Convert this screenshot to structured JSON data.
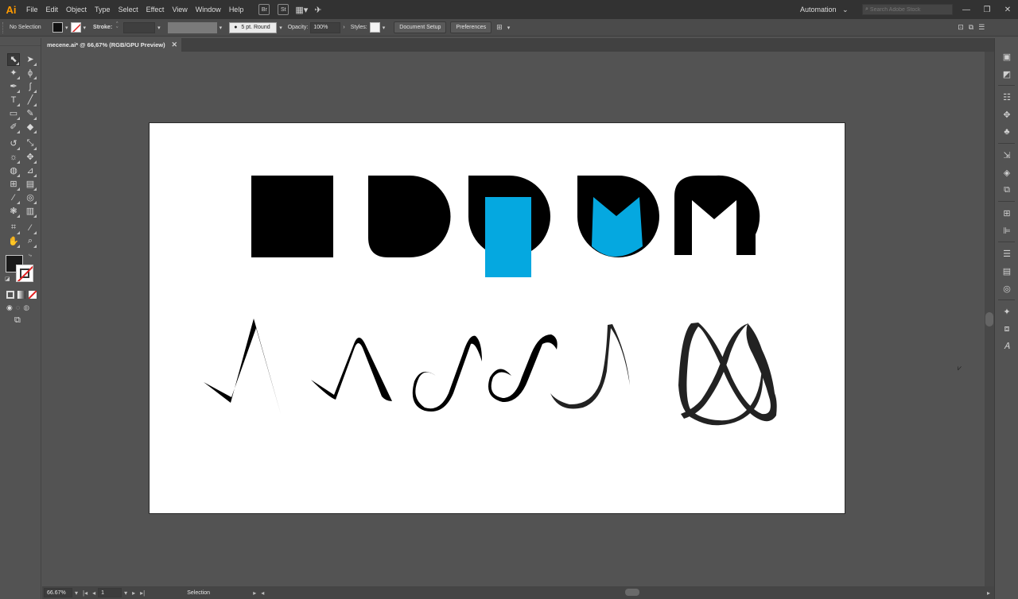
{
  "app": {
    "logo": "Ai",
    "accent": "#ff9a00"
  },
  "menubar": {
    "items": [
      "File",
      "Edit",
      "Object",
      "Type",
      "Select",
      "Effect",
      "View",
      "Window",
      "Help"
    ],
    "bridge": "Br",
    "stock": "St",
    "workspace": "Automation",
    "search_placeholder": "Search Adobe Stock",
    "window_controls": {
      "minimize": "—",
      "restore": "❐",
      "close": "✕"
    }
  },
  "controlbar": {
    "selection_label": "No Selection",
    "stroke_label": "Stroke:",
    "brush": "5 pt. Round",
    "opacity_label": "Opacity:",
    "opacity_value": "100%",
    "styles_label": "Styles:",
    "document_setup": "Document Setup",
    "preferences": "Preferences"
  },
  "tab": {
    "title": "mecene.ai* @ 66,67% (RGB/GPU Preview)",
    "close": "✕"
  },
  "statusbar": {
    "zoom": "66.67%",
    "artboard": "1",
    "mode": "Selection"
  },
  "colors": {
    "accent_blue": "#05a8e0",
    "ink": "#000000",
    "stroke_dark": "#222222"
  }
}
